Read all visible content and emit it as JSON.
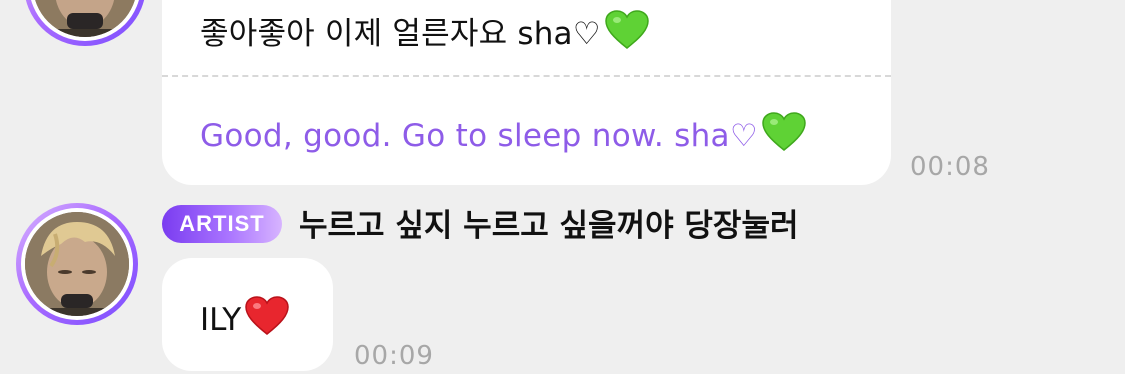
{
  "messages": [
    {
      "original": "좋아좋아 이제 얼른자요 sha♡",
      "original_emoji": "green-heart",
      "translation": "Good, good. Go to sleep now. sha♡",
      "translation_emoji": "green-heart",
      "time": "00:08"
    },
    {
      "badge": "ARTIST",
      "sender": "누르고 싶지 누르고 싶을꺼야 당장눌러",
      "text": "ILY",
      "text_emoji": "red-heart",
      "time": "00:09"
    }
  ],
  "colors": {
    "background": "#efefef",
    "bubble": "#ffffff",
    "translation_text": "#8e5ce8",
    "timestamp": "#a7a7a7",
    "badge_gradient_start": "#7a3cf0",
    "badge_gradient_end": "#d7b4ff",
    "avatar_ring": "#a96bff"
  }
}
